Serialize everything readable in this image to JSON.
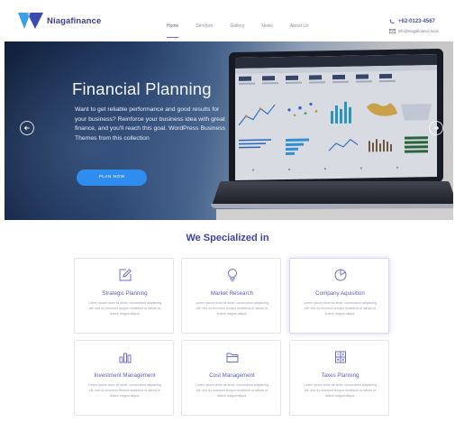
{
  "brand": {
    "name": "Niagafinance"
  },
  "nav": {
    "items": [
      {
        "label": "Home",
        "active": true
      },
      {
        "label": "Services",
        "active": false
      },
      {
        "label": "Gallery",
        "active": false
      },
      {
        "label": "News",
        "active": false
      },
      {
        "label": "About Us",
        "active": false
      }
    ]
  },
  "contact": {
    "phone": "+62-0123-4567",
    "email": "info@niagafinance.local"
  },
  "hero": {
    "title": "Financial Planning",
    "body": "Want to get reliable performance and good results for your business? Reinforce your business idea with great finance, and you'll reach this goal. WordPress Business Themes from this collection",
    "cta": "PLAN NOW"
  },
  "services": {
    "title": "We Specialized in",
    "cards": [
      {
        "title": "Strategic Planning",
        "icon": "edit-icon",
        "body": "Lorem ipsum dolor sit amet, consectetur adipiscing elit, sed do eiusmod tempor incididunt ut labore et dolore magna aliqua."
      },
      {
        "title": "Market Research",
        "icon": "bulb-icon",
        "body": "Lorem ipsum dolor sit amet, consectetur adipiscing elit, sed do eiusmod tempor incididunt ut labore et dolore magna aliqua."
      },
      {
        "title": "Company Aquisition",
        "icon": "pie-chart-icon",
        "body": "Lorem ipsum dolor sit amet, consectetur adipiscing elit, sed do eiusmod tempor incididunt ut labore et dolore magna aliqua."
      },
      {
        "title": "Investment Management",
        "icon": "bar-chart-icon",
        "body": "Lorem ipsum dolor sit amet, consectetur adipiscing elit, sed do eiusmod tempor incididunt ut labore et dolore magna aliqua."
      },
      {
        "title": "Cost Management",
        "icon": "folder-icon",
        "body": "Lorem ipsum dolor sit amet, consectetur adipiscing elit, sed do eiusmod tempor incididunt ut labore et dolore magna aliqua."
      },
      {
        "title": "Taxes Planning",
        "icon": "calculator-icon",
        "body": "Lorem ipsum dolor sit amet, consectetur adipiscing elit, sed do eiusmod tempor incididunt ut labore et dolore magna aliqua."
      }
    ]
  },
  "colors": {
    "accent": "#5a5fc2",
    "brand": "#3a3f8f",
    "button": "#2f8df0"
  }
}
